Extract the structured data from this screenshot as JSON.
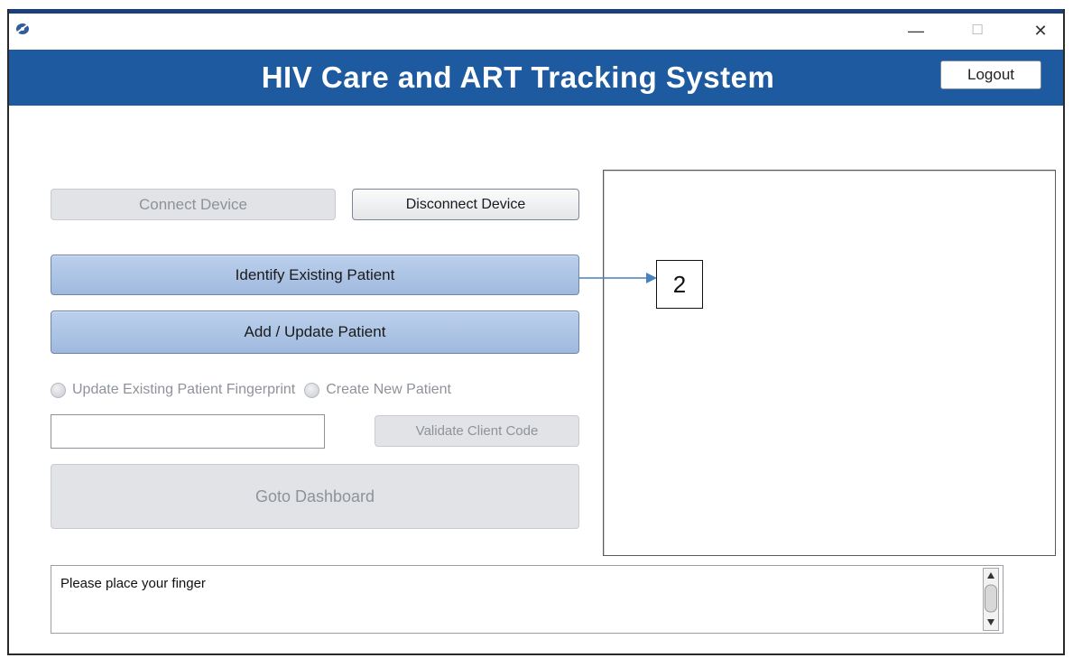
{
  "window": {
    "icon": "app-logo-icon",
    "controls": {
      "minimize": "—",
      "maximize": "☐",
      "close": "✕"
    }
  },
  "header": {
    "title": "HIV Care and ART Tracking System",
    "logout_label": "Logout",
    "color": "#1e5aa0"
  },
  "device": {
    "connect_label": "Connect Device",
    "disconnect_label": "Disconnect Device"
  },
  "actions": {
    "identify_label": "Identify Existing Patient",
    "add_update_label": "Add / Update Patient"
  },
  "options": {
    "update_fingerprint_label": "Update Existing Patient Fingerprint",
    "create_new_label": "Create New Patient"
  },
  "client_code": {
    "value": "",
    "validate_label": "Validate Client Code"
  },
  "dashboard": {
    "goto_label": "Goto Dashboard"
  },
  "callout": {
    "label": "2"
  },
  "status": {
    "message": "Please place your finger"
  },
  "colors": {
    "accent_blue": "#9fb9de",
    "disabled_text": "#8e939a"
  }
}
